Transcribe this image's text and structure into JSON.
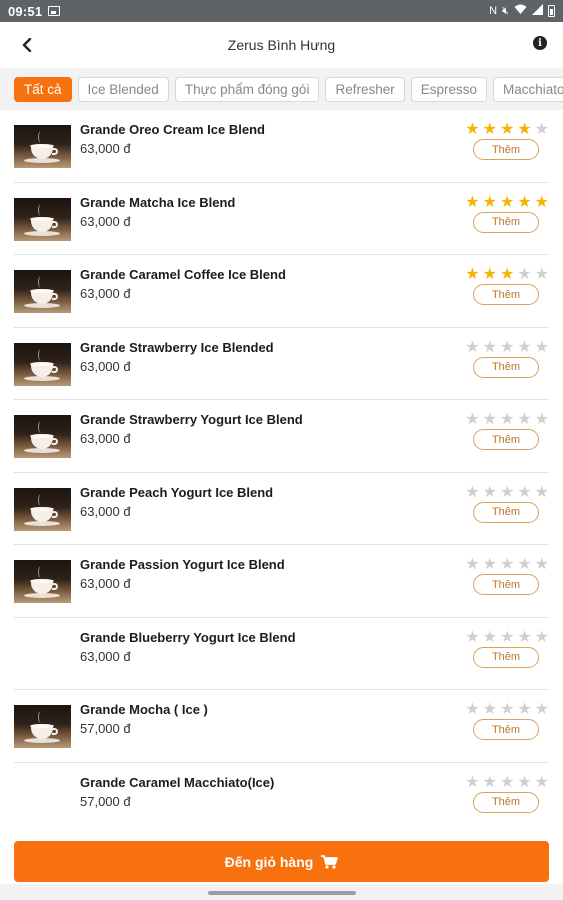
{
  "status_bar": {
    "time": "09:51",
    "icons": [
      "image-icon",
      "nfc-icon",
      "mute-icon",
      "wifi-icon",
      "signal-icon",
      "battery-icon"
    ]
  },
  "header": {
    "title": "Zerus Bình Hưng",
    "back_icon": "chevron-left-icon",
    "info_icon": "info-icon"
  },
  "tabs": [
    {
      "label": "Tất cả",
      "active": true
    },
    {
      "label": "Ice Blended",
      "active": false
    },
    {
      "label": "Thực phẩm đóng gói",
      "active": false
    },
    {
      "label": "Refresher",
      "active": false
    },
    {
      "label": "Espresso",
      "active": false
    },
    {
      "label": "Macchiato",
      "active": false
    }
  ],
  "products": [
    {
      "name": "Grande Oreo Cream Ice Blend",
      "price": "63,000 đ",
      "rating": 4,
      "has_image": true,
      "add_label": "Thêm"
    },
    {
      "name": "Grande Matcha Ice Blend",
      "price": "63,000 đ",
      "rating": 5,
      "has_image": true,
      "add_label": "Thêm"
    },
    {
      "name": "Grande Caramel Coffee Ice Blend",
      "price": "63,000 đ",
      "rating": 3,
      "has_image": true,
      "add_label": "Thêm"
    },
    {
      "name": "Grande Strawberry Ice Blended",
      "price": "63,000 đ",
      "rating": 0,
      "has_image": true,
      "add_label": "Thêm"
    },
    {
      "name": "Grande Strawberry Yogurt Ice Blend",
      "price": "63,000 đ",
      "rating": 0,
      "has_image": true,
      "add_label": "Thêm"
    },
    {
      "name": "Grande Peach Yogurt Ice Blend",
      "price": "63,000 đ",
      "rating": 0,
      "has_image": true,
      "add_label": "Thêm"
    },
    {
      "name": "Grande Passion  Yogurt Ice Blend",
      "price": "63,000 đ",
      "rating": 0,
      "has_image": true,
      "add_label": "Thêm"
    },
    {
      "name": "Grande Blueberry Yogurt Ice Blend",
      "price": "63,000 đ",
      "rating": 0,
      "has_image": false,
      "add_label": "Thêm"
    },
    {
      "name": "Grande Mocha ( Ice )",
      "price": "57,000 đ",
      "rating": 0,
      "has_image": true,
      "add_label": "Thêm"
    },
    {
      "name": "Grande Caramel Macchiato(Ice)",
      "price": "57,000 đ",
      "rating": 0,
      "has_image": false,
      "add_label": "Thêm"
    }
  ],
  "cart_button": {
    "label": "Đến giỏ hàng",
    "icon": "cart-icon"
  },
  "colors": {
    "accent": "#f7710f",
    "star_on": "#f4b400",
    "star_off": "#cfcfcf",
    "add_border": "#d9a35a"
  }
}
